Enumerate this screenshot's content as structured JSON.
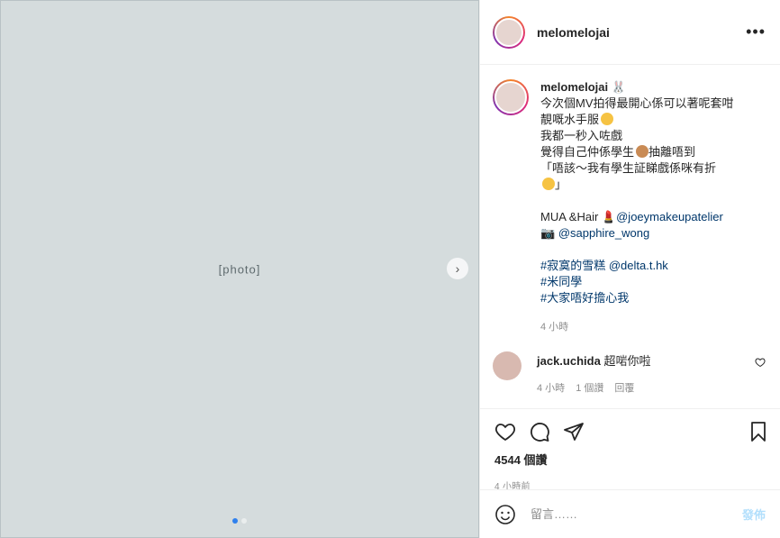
{
  "photo": {
    "label": "[photo]"
  },
  "header": {
    "username": "melomelojai",
    "more_glyph": "•••"
  },
  "caption": {
    "username": "melomelojai",
    "lines": [
      "今次個MV拍得最開心係可以著呢套咁",
      "靚嘅水手服",
      "我都一秒入咗戲",
      "覺得自己仲係學生",
      "抽離唔到",
      "「唔該～我有學生証睇戲係咪有折",
      "」"
    ],
    "credit_mua": "MUA &Hair",
    "credit_mua_handle": "@joeymakeupatelier",
    "credit_photo_handle": "@sapphire_wong",
    "tag_line_1": "#寂寞的雪糕",
    "tag_line_1_handle": "@delta.t.hk",
    "tag_line_2": "#米同學",
    "tag_line_3": "#大家唔好擔心我",
    "time": "4 小時"
  },
  "comment": {
    "username": "jack.uchida",
    "text": "超啱你啦",
    "time": "4 小時",
    "likes": "1 個讚",
    "reply": "回覆"
  },
  "actions": {
    "likes": "4544 個讚",
    "posted": "4 小時前"
  },
  "comment_box": {
    "placeholder": "留言……",
    "post_label": "發佈"
  },
  "colors": {
    "link": "#00376b",
    "post_button": "#b2dffc",
    "meta": "#8e8e8e"
  }
}
